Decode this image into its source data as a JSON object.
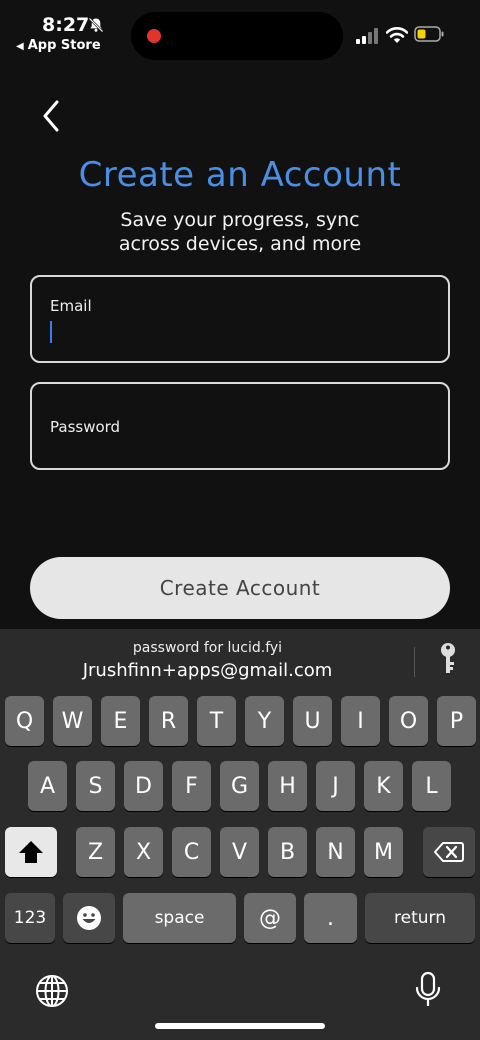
{
  "status_bar": {
    "time": "8:27",
    "back_app": "App Store",
    "back_arrow": "◀"
  },
  "screen": {
    "title": "Create an Account",
    "subtitle": "Save your progress, sync across devices, and more",
    "email_label": "Email",
    "password_label": "Password",
    "create_button": "Create Account",
    "accent_color": "#4a8ee6"
  },
  "keyboard": {
    "suggestion_sub": "password for lucid.fyi",
    "suggestion_main": "Jrushfinn+apps@gmail.com",
    "row1": [
      "Q",
      "W",
      "E",
      "R",
      "T",
      "Y",
      "U",
      "I",
      "O",
      "P"
    ],
    "row2": [
      "A",
      "S",
      "D",
      "F",
      "G",
      "H",
      "J",
      "K",
      "L"
    ],
    "row3": [
      "Z",
      "X",
      "C",
      "V",
      "B",
      "N",
      "M"
    ],
    "numbers_label": "123",
    "space_label": "space",
    "at_label": "@",
    "period_label": ".",
    "return_label": "return"
  }
}
